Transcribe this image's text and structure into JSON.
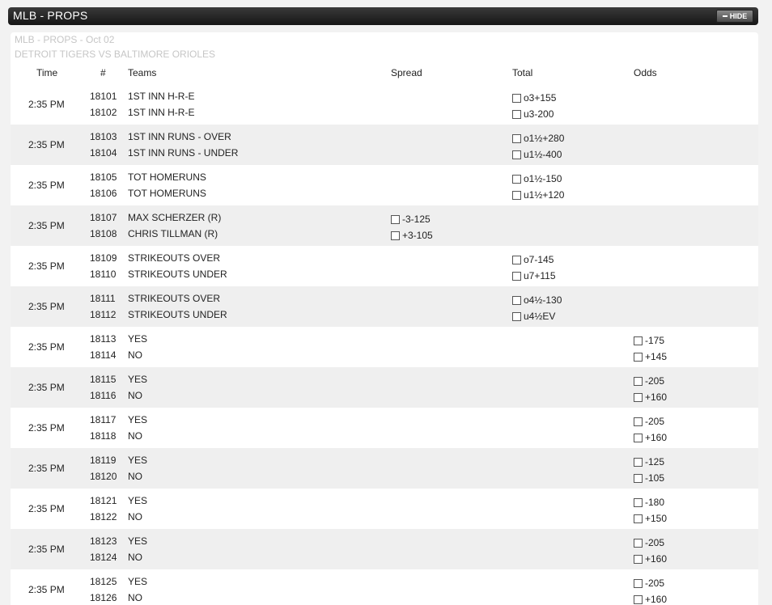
{
  "window": {
    "title": "MLB - PROPS",
    "hide_label": "HIDE"
  },
  "subtitle": {
    "line1": "MLB - PROPS - Oct 02",
    "line2": "DETROIT TIGERS VS BALTIMORE ORIOLES"
  },
  "columns": {
    "time": "Time",
    "num": "#",
    "teams": "Teams",
    "spread": "Spread",
    "total": "Total",
    "odds": "Odds"
  },
  "rows": [
    {
      "time": "2:35 PM",
      "num1": "18101",
      "team1": "1ST INN H-R-E",
      "num2": "18102",
      "team2": "1ST INN H-R-E",
      "kind": "total",
      "bet1": "o3+155",
      "bet2": "u3-200"
    },
    {
      "time": "2:35 PM",
      "num1": "18103",
      "team1": "1ST INN RUNS - OVER",
      "num2": "18104",
      "team2": "1ST INN RUNS - UNDER",
      "kind": "total",
      "bet1": "o1½+280",
      "bet2": "u1½-400"
    },
    {
      "time": "2:35 PM",
      "num1": "18105",
      "team1": "TOT HOMERUNS",
      "num2": "18106",
      "team2": "TOT HOMERUNS",
      "kind": "total",
      "bet1": "o1½-150",
      "bet2": "u1½+120"
    },
    {
      "time": "2:35 PM",
      "num1": "18107",
      "team1": "MAX SCHERZER (R)",
      "num2": "18108",
      "team2": "CHRIS TILLMAN (R)",
      "kind": "spread",
      "bet1": "-3-125",
      "bet2": "+3-105"
    },
    {
      "time": "2:35 PM",
      "num1": "18109",
      "team1": "STRIKEOUTS OVER",
      "num2": "18110",
      "team2": "STRIKEOUTS UNDER",
      "kind": "total",
      "bet1": "o7-145",
      "bet2": "u7+115"
    },
    {
      "time": "2:35 PM",
      "num1": "18111",
      "team1": "STRIKEOUTS OVER",
      "num2": "18112",
      "team2": "STRIKEOUTS UNDER",
      "kind": "total",
      "bet1": "o4½-130",
      "bet2": "u4½EV"
    },
    {
      "time": "2:35 PM",
      "num1": "18113",
      "team1": "YES",
      "num2": "18114",
      "team2": "NO",
      "kind": "odds",
      "bet1": "-175",
      "bet2": "+145"
    },
    {
      "time": "2:35 PM",
      "num1": "18115",
      "team1": "YES",
      "num2": "18116",
      "team2": "NO",
      "kind": "odds",
      "bet1": "-205",
      "bet2": "+160"
    },
    {
      "time": "2:35 PM",
      "num1": "18117",
      "team1": "YES",
      "num2": "18118",
      "team2": "NO",
      "kind": "odds",
      "bet1": "-205",
      "bet2": "+160"
    },
    {
      "time": "2:35 PM",
      "num1": "18119",
      "team1": "YES",
      "num2": "18120",
      "team2": "NO",
      "kind": "odds",
      "bet1": "-125",
      "bet2": "-105"
    },
    {
      "time": "2:35 PM",
      "num1": "18121",
      "team1": "YES",
      "num2": "18122",
      "team2": "NO",
      "kind": "odds",
      "bet1": "-180",
      "bet2": "+150"
    },
    {
      "time": "2:35 PM",
      "num1": "18123",
      "team1": "YES",
      "num2": "18124",
      "team2": "NO",
      "kind": "odds",
      "bet1": "-205",
      "bet2": "+160"
    },
    {
      "time": "2:35 PM",
      "num1": "18125",
      "team1": "YES",
      "num2": "18126",
      "team2": "NO",
      "kind": "odds",
      "bet1": "-205",
      "bet2": "+160"
    }
  ]
}
